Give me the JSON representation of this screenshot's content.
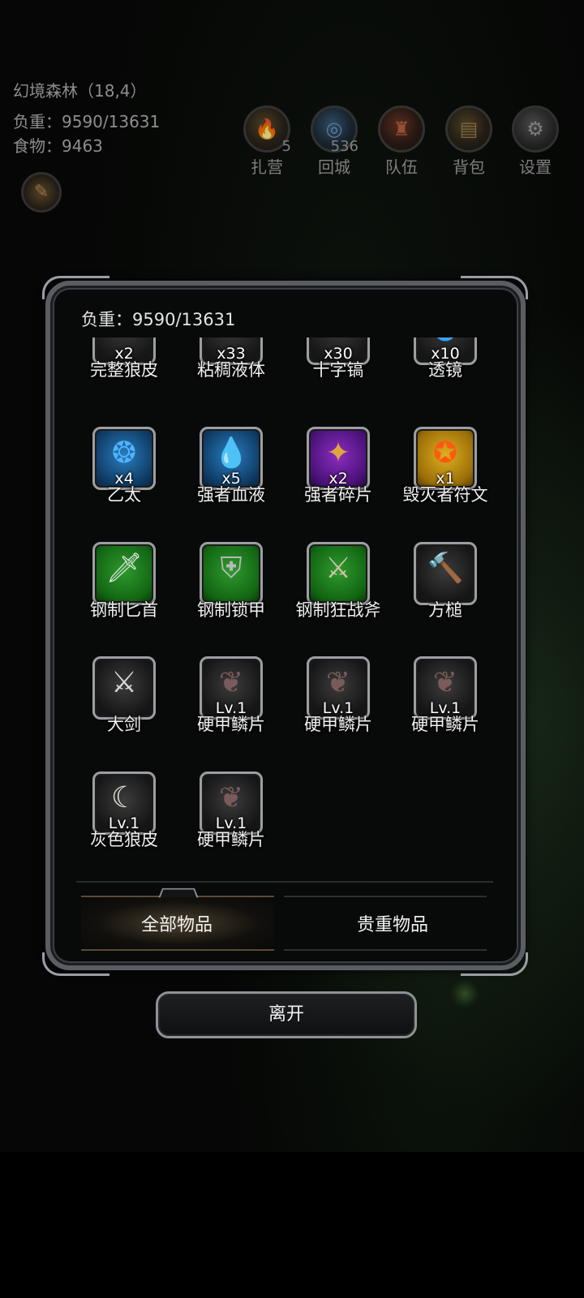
{
  "hud": {
    "location": "幻境森林（18,4）",
    "load": "负重：9590/13631",
    "food": "食物：9463",
    "buttons": [
      {
        "label": "扎营",
        "badge": "5",
        "icon": "campfire-icon"
      },
      {
        "label": "回城",
        "badge": "536",
        "icon": "portal-icon"
      },
      {
        "label": "队伍",
        "badge": "",
        "icon": "team-icon"
      },
      {
        "label": "背包",
        "badge": "",
        "icon": "backpack-icon"
      },
      {
        "label": "设置",
        "badge": "",
        "icon": "gear-icon"
      }
    ],
    "map_icon": "map-scroll-icon"
  },
  "panel": {
    "load": "负重：9590/13631",
    "items": [
      {
        "name": "完整狼皮",
        "qty": "x2",
        "rarity": "grey",
        "icon": "wolf-pelt-icon"
      },
      {
        "name": "粘稠液体",
        "qty": "x33",
        "rarity": "grey",
        "icon": "sticky-liquid-icon"
      },
      {
        "name": "十字镐",
        "qty": "x30",
        "rarity": "grey",
        "icon": "pickaxe-icon"
      },
      {
        "name": "透镜",
        "qty": "x10",
        "rarity": "grey",
        "icon": "lens-icon"
      },
      {
        "name": "乙太",
        "qty": "x4",
        "rarity": "blue",
        "icon": "ether-orb-icon"
      },
      {
        "name": "强者血液",
        "qty": "x5",
        "rarity": "blue",
        "icon": "blood-drop-icon"
      },
      {
        "name": "强者碎片",
        "qty": "x2",
        "rarity": "purple",
        "icon": "shard-icon"
      },
      {
        "name": "毁灭者符文",
        "qty": "x1",
        "rarity": "gold",
        "icon": "rune-icon"
      },
      {
        "name": "钢制匕首",
        "qty": "",
        "rarity": "green",
        "icon": "dagger-icon"
      },
      {
        "name": "钢制锁甲",
        "qty": "",
        "rarity": "green",
        "icon": "chainmail-icon"
      },
      {
        "name": "钢制狂战斧",
        "qty": "",
        "rarity": "green",
        "icon": "battle-axe-icon"
      },
      {
        "name": "方槌",
        "qty": "",
        "rarity": "dark",
        "icon": "hammer-icon"
      },
      {
        "name": "大剑",
        "qty": "",
        "rarity": "dark",
        "icon": "greatsword-icon"
      },
      {
        "name": "硬甲鳞片",
        "qty": "Lv.1",
        "rarity": "dark",
        "icon": "scale-icon"
      },
      {
        "name": "硬甲鳞片",
        "qty": "Lv.1",
        "rarity": "dark",
        "icon": "scale-icon"
      },
      {
        "name": "硬甲鳞片",
        "qty": "Lv.1",
        "rarity": "dark",
        "icon": "scale-icon"
      },
      {
        "name": "灰色狼皮",
        "qty": "Lv.1",
        "rarity": "dark",
        "icon": "grey-fur-icon"
      },
      {
        "name": "硬甲鳞片",
        "qty": "Lv.1",
        "rarity": "dark",
        "icon": "scale-icon"
      }
    ],
    "tabs": [
      {
        "label": "全部物品",
        "active": true
      },
      {
        "label": "贵重物品",
        "active": false
      }
    ]
  },
  "exit_label": "离开"
}
